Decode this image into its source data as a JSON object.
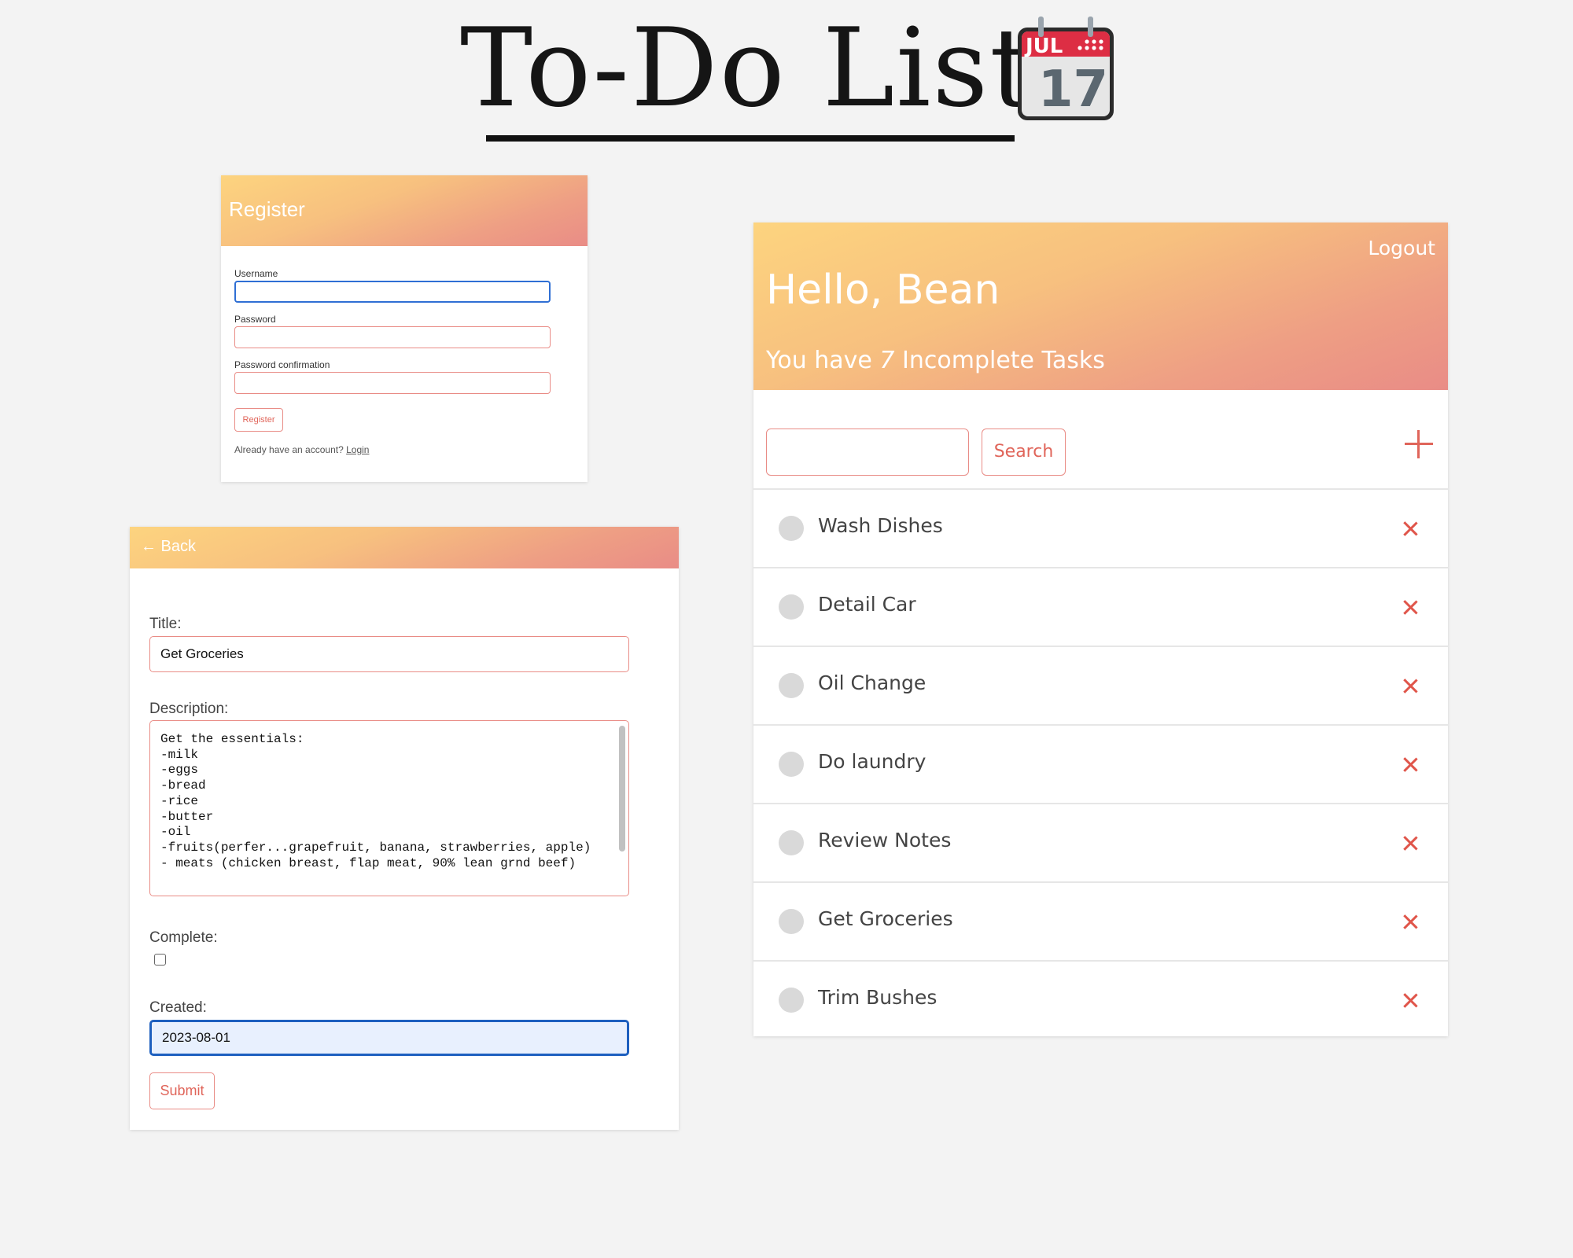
{
  "page": {
    "title": "To-Do List"
  },
  "register": {
    "heading": "Register",
    "username_label": "Username",
    "password_label": "Password",
    "password_confirm_label": "Password confirmation",
    "submit_label": "Register",
    "footer_text": "Already have an account? ",
    "login_link": "Login"
  },
  "edit_task": {
    "back_label": "← Back",
    "title_label": "Title:",
    "title_value": "Get Groceries",
    "description_label": "Description:",
    "description_value": "Get the essentials:\n-milk\n-eggs\n-bread\n-rice\n-butter\n-oil\n-fruits(perfer...grapefruit, banana, strawberries, apple)\n- meats (chicken breast, flap meat, 90% lean grnd beef)",
    "complete_label": "Complete:",
    "complete_checked": false,
    "created_label": "Created:",
    "created_value": "2023-08-01",
    "submit_label": "Submit"
  },
  "task_list": {
    "logout_label": "Logout",
    "greeting": "Hello, Bean",
    "incomplete_prefix": "You have ",
    "incomplete_count": "7",
    "incomplete_suffix": " Incomplete Tasks",
    "search_value": "",
    "search_button_label": "Search",
    "tasks": [
      {
        "title": "Wash Dishes",
        "complete": false
      },
      {
        "title": "Detail Car",
        "complete": false
      },
      {
        "title": "Oil Change",
        "complete": false
      },
      {
        "title": "Do laundry",
        "complete": false
      },
      {
        "title": "Review Notes",
        "complete": false
      },
      {
        "title": "Get Groceries",
        "complete": false
      },
      {
        "title": "Trim Bushes",
        "complete": false
      }
    ]
  },
  "icons": {
    "calendar": "calendar-icon",
    "calendar_month": "JUL",
    "calendar_day": "17",
    "add": "plus-icon",
    "delete": "close-icon",
    "checkbox": "circle-check-icon"
  },
  "colors": {
    "background": "#f3f3f3",
    "gradient_start": "#fdd47f",
    "gradient_end": "#e98c86",
    "accent": "#e0655a",
    "focus_blue": "#1d5fbf"
  }
}
